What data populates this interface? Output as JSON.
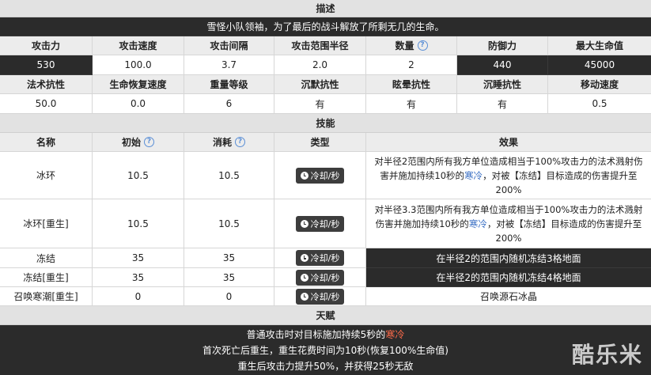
{
  "description": {
    "title": "描述",
    "text": "雪怪小队领袖，为了最后的战斗解放了所剩无几的生命。"
  },
  "stats1": {
    "headers": [
      "攻击力",
      "攻击速度",
      "攻击间隔",
      "攻击范围半径",
      "数量",
      "防御力",
      "最大生命值"
    ],
    "values": [
      "530",
      "100.0",
      "3.7",
      "2.0",
      "2",
      "440",
      "45000"
    ]
  },
  "stats2": {
    "headers": [
      "法术抗性",
      "生命恢复速度",
      "重量等级",
      "沉默抗性",
      "眩晕抗性",
      "沉睡抗性",
      "移动速度"
    ],
    "values": [
      "50.0",
      "0.0",
      "6",
      "有",
      "有",
      "有",
      "0.5"
    ]
  },
  "skills": {
    "title": "技能",
    "headers": {
      "name": "名称",
      "initial": "初始",
      "cost": "消耗",
      "type": "类型",
      "effect": "效果"
    },
    "type_label": "冷却/秒",
    "rows": [
      {
        "name": "冰环",
        "initial": "10.5",
        "cost": "10.5",
        "effect_pre": "对半径2范围内所有我方单位造成相当于100%攻击力的法术溅射伤害并施加持续10秒的",
        "effect_cold": "寒冷",
        "effect_post": "，对被【冻结】目标造成的伤害提升至200%"
      },
      {
        "name": "冰环[重生]",
        "initial": "10.5",
        "cost": "10.5",
        "effect_pre": "对半径3.3范围内所有我方单位造成相当于100%攻击力的法术溅射伤害并施加持续10秒的",
        "effect_cold": "寒冷",
        "effect_post": "，对被【冻结】目标造成的伤害提升至200%"
      },
      {
        "name": "冻结",
        "initial": "35",
        "cost": "35",
        "effect": "在半径2的范围内随机冻结3格地面"
      },
      {
        "name": "冻结[重生]",
        "initial": "35",
        "cost": "35",
        "effect": "在半径2的范围内随机冻结4格地面"
      },
      {
        "name": "召唤寒潮[重生]",
        "initial": "0",
        "cost": "0",
        "effect": "召唤源石冰晶"
      }
    ]
  },
  "talent": {
    "title": "天赋",
    "line1_pre": "普通攻击时对目标施加持续5秒的",
    "line1_cold": "寒冷",
    "line2": "首次死亡后重生，重生花费时间为10秒(恢复100%生命值)",
    "line3": "重生后攻击力提升50%，并获得25秒无敌"
  },
  "watermark": "酷乐米",
  "help_icon_symbol": "?"
}
